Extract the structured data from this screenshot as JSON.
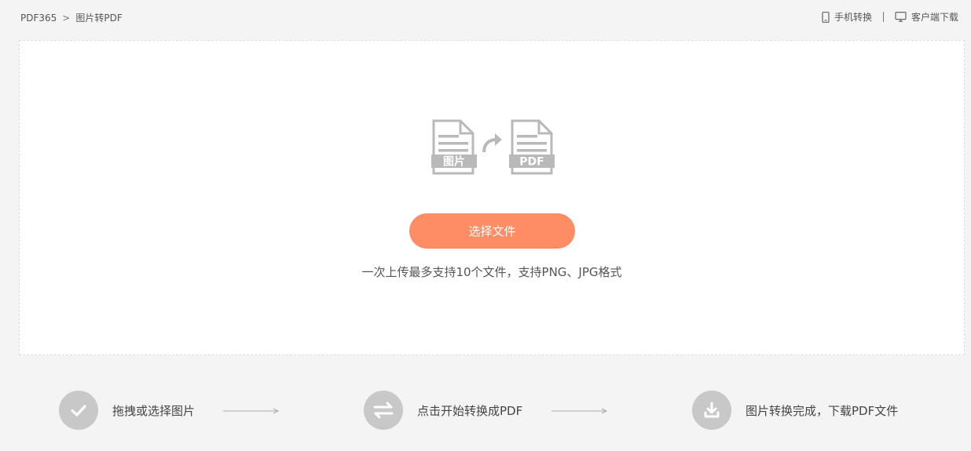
{
  "breadcrumb": {
    "root": "PDF365",
    "separator": ">",
    "current": "图片转PDF"
  },
  "top_links": {
    "mobile": {
      "label": "手机转换",
      "icon": "mobile-phone-icon"
    },
    "desktop": {
      "label": "客户端下载",
      "icon": "monitor-icon"
    }
  },
  "upload": {
    "illustration": {
      "source_label": "图片",
      "target_label": "PDF",
      "arrow_icon": "curved-arrow-icon"
    },
    "button_label": "选择文件",
    "hint": "一次上传最多支持10个文件，支持PNG、JPG格式"
  },
  "steps": [
    {
      "icon": "check-icon",
      "label": "拖拽或选择图片"
    },
    {
      "icon": "swap-arrows-icon",
      "label": "点击开始转换成PDF"
    },
    {
      "icon": "download-icon",
      "label": "图片转换完成，下载PDF文件"
    }
  ],
  "colors": {
    "accent": "#fe8c64",
    "background": "#f4f4f4",
    "step_circle": "#c8c8c8",
    "illustration": "#b9b9b9"
  }
}
